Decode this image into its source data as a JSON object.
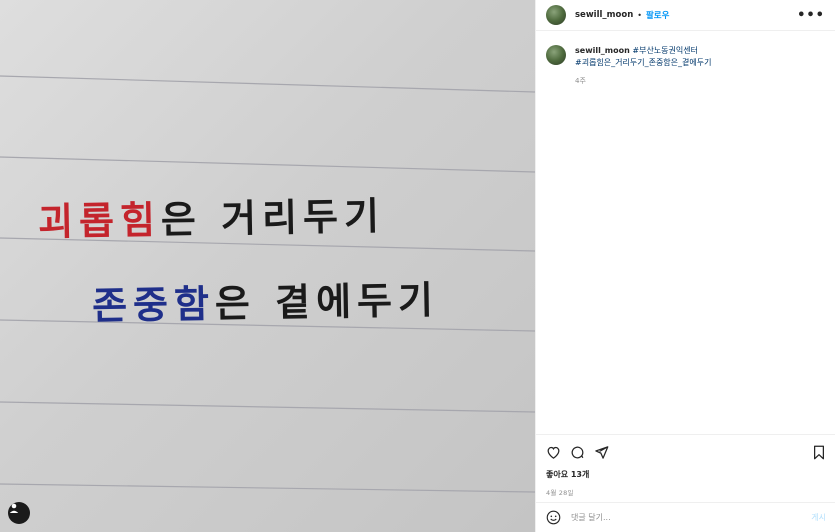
{
  "post": {
    "image": {
      "line1_red": "괴롭힘",
      "line1_black": "은 거리두기",
      "line2_blue": "존중함",
      "line2_black": "은 곁에두기"
    },
    "author": "sewill_moon",
    "follow_label": "팔로우",
    "more_label": "•••",
    "caption": {
      "username": "sewill_moon",
      "hashtag1": "#부산노동권익센터",
      "hashtag2": "#괴롭힘은_거리두기_존중함은_곁에두기"
    },
    "caption_age": "4주",
    "likes_text": "좋아요 13개",
    "date_text": "4월 28일",
    "comment_placeholder": "댓글 달기...",
    "post_label": "게시"
  },
  "colors": {
    "link": "#0095f6",
    "hashtag": "#00376b",
    "ink_red": "#c4242c",
    "ink_blue": "#1f2f8a",
    "ink_black": "#1a1a1a"
  },
  "icons": [
    "heart-icon",
    "comment-icon",
    "share-icon",
    "bookmark-icon",
    "emoji-icon",
    "user-tag-icon",
    "more-icon"
  ]
}
